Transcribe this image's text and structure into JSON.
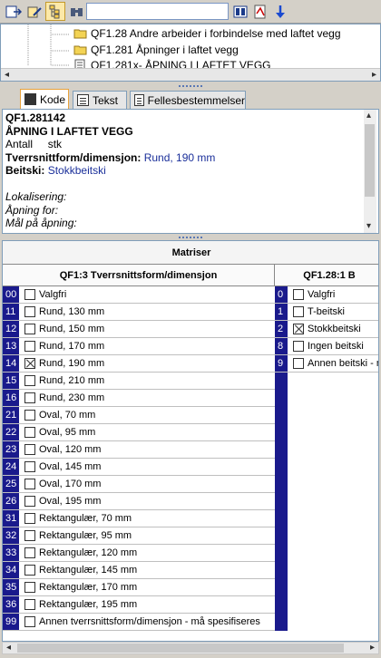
{
  "toolbar": {
    "buttons": [
      "export-icon",
      "edit-icon",
      "tree-view-icon",
      "binoculars-icon"
    ],
    "right_buttons": [
      "bookmark-icon",
      "pdf-icon",
      "arrow-down-icon"
    ],
    "search_value": ""
  },
  "tree": {
    "items": [
      {
        "label": "QF1.28 Andre arbeider i forbindelse med laftet vegg",
        "icon": "folder-icon"
      },
      {
        "label": "QF1.281 Åpninger i laftet vegg",
        "icon": "folder-icon"
      },
      {
        "label": "QF1.281x- ÅPNING I LAFTET VEGG",
        "icon": "document-icon"
      }
    ]
  },
  "tabs": [
    {
      "label": "Kode",
      "active": true
    },
    {
      "label": "Tekst",
      "active": false
    },
    {
      "label": "Fellesbestemmelser",
      "active": false
    }
  ],
  "description": {
    "code": "QF1.281142",
    "title": "ÅPNING I LAFTET VEGG",
    "unit_label": "Antall",
    "unit_value": "stk",
    "prop1_label": "Tverrsnittform/dimensjon:",
    "prop1_value": "Rund, 190 mm",
    "prop2_label": "Beitski:",
    "prop2_value": "Stokkbeitski",
    "fields": [
      "Lokalisering:",
      "Åpning for:",
      "Mål på åpning:"
    ]
  },
  "matrix": {
    "title": "Matriser",
    "col1_header": "QF1:3 Tverrsnittsform/dimensjon",
    "col2_header": "QF1.28:1 B",
    "col1_rows": [
      {
        "code": "00",
        "label": "Valgfri",
        "checked": false
      },
      {
        "code": "11",
        "label": "Rund, 130 mm",
        "checked": false
      },
      {
        "code": "12",
        "label": "Rund, 150 mm",
        "checked": false
      },
      {
        "code": "13",
        "label": "Rund, 170 mm",
        "checked": false
      },
      {
        "code": "14",
        "label": "Rund, 190 mm",
        "checked": true
      },
      {
        "code": "15",
        "label": "Rund, 210 mm",
        "checked": false
      },
      {
        "code": "16",
        "label": "Rund, 230 mm",
        "checked": false
      },
      {
        "code": "21",
        "label": "Oval, 70 mm",
        "checked": false
      },
      {
        "code": "22",
        "label": "Oval, 95 mm",
        "checked": false
      },
      {
        "code": "23",
        "label": "Oval, 120 mm",
        "checked": false
      },
      {
        "code": "24",
        "label": "Oval, 145 mm",
        "checked": false
      },
      {
        "code": "25",
        "label": "Oval, 170 mm",
        "checked": false
      },
      {
        "code": "26",
        "label": "Oval, 195 mm",
        "checked": false
      },
      {
        "code": "31",
        "label": "Rektangulær, 70 mm",
        "checked": false
      },
      {
        "code": "32",
        "label": "Rektangulær, 95 mm",
        "checked": false
      },
      {
        "code": "33",
        "label": "Rektangulær, 120 mm",
        "checked": false
      },
      {
        "code": "34",
        "label": "Rektangulær, 145 mm",
        "checked": false
      },
      {
        "code": "35",
        "label": "Rektangulær, 170 mm",
        "checked": false
      },
      {
        "code": "36",
        "label": "Rektangulær, 195 mm",
        "checked": false
      },
      {
        "code": "99",
        "label": "Annen tverrsnittsform/dimensjon - må spesifiseres",
        "checked": false
      }
    ],
    "col2_rows": [
      {
        "code": "0",
        "label": "Valgfri",
        "checked": false
      },
      {
        "code": "1",
        "label": "T-beitski",
        "checked": false
      },
      {
        "code": "2",
        "label": "Stokkbeitski",
        "checked": true
      },
      {
        "code": "8",
        "label": "Ingen beitski",
        "checked": false
      },
      {
        "code": "9",
        "label": "Annen beitski - m",
        "checked": false
      }
    ]
  },
  "colors": {
    "code_strip": "#1a1a8c",
    "tab_active_border": "#e8a23c",
    "blue_text": "#1a2f9a"
  }
}
